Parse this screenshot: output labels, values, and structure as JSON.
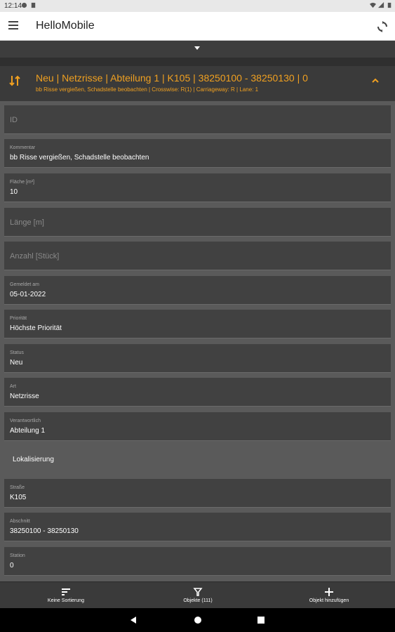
{
  "status_bar": {
    "time": "12:14"
  },
  "app_bar": {
    "title": "HelloMobile"
  },
  "header": {
    "title": "Neu | Netzrisse | Abteilung 1 | K105 | 38250100 - 38250130 | 0",
    "subtitle": "bb Risse vergießen, Schadstelle beobachten | Crosswise: R(1) | Carriageway: R | Lane: 1"
  },
  "fields": {
    "id": {
      "placeholder": "ID"
    },
    "kommentar": {
      "label": "Kommentar",
      "value": "bb Risse vergießen, Schadstelle beobachten"
    },
    "flaeche": {
      "label": "Fläche [m²]",
      "value": "10"
    },
    "laenge": {
      "placeholder": "Länge [m]"
    },
    "anzahl": {
      "placeholder": "Anzahl [Stück]"
    },
    "gemeldet": {
      "label": "Gemeldet am",
      "value": "05-01-2022"
    },
    "prioritaet": {
      "label": "Priorität",
      "value": "Höchste Priorität"
    },
    "status": {
      "label": "Status",
      "value": "Neu"
    },
    "art": {
      "label": "Art",
      "value": "Netzrisse"
    },
    "verantwortlich": {
      "label": "Verantwortlich",
      "value": "Abteilung 1"
    },
    "strasse": {
      "label": "Straße",
      "value": "K105"
    },
    "abschnitt": {
      "label": "Abschnitt",
      "value": "38250100 - 38250130"
    },
    "station": {
      "label": "Station",
      "value": "0"
    }
  },
  "section": {
    "lokalisierung": "Lokalisierung"
  },
  "bottom_nav": {
    "sort": "Keine Sortierung",
    "objects": "Objekte (111)",
    "add": "Objekt hinzufügen"
  },
  "colors": {
    "accent": "#f0a020",
    "field_bg": "#414141",
    "header_bg": "#3a3a3a"
  }
}
